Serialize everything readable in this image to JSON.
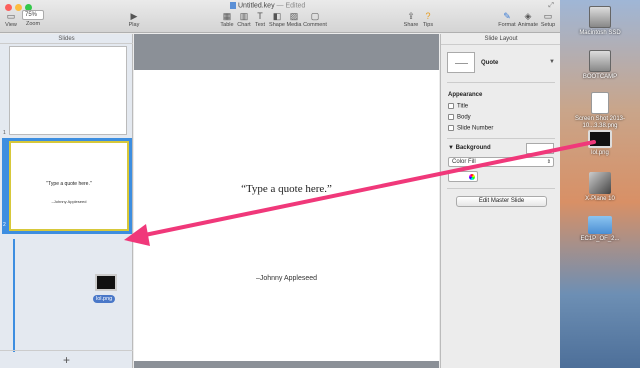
{
  "window": {
    "title": "Untitled.key",
    "status": "— Edited"
  },
  "toolbar": {
    "view_label": "View",
    "zoom_label": "Zoom",
    "zoom_value": "75%",
    "play_label": "Play",
    "table_label": "Table",
    "chart_label": "Chart",
    "text_label": "Text",
    "shape_label": "Shape",
    "media_label": "Media",
    "comment_label": "Comment",
    "share_label": "Share",
    "tips_label": "Tips",
    "format_label": "Format",
    "animate_label": "Animate",
    "setup_label": "Setup"
  },
  "sidebar": {
    "header": "Slides",
    "slides": [
      {
        "number": "1",
        "quote": "",
        "attribution": ""
      },
      {
        "number": "2",
        "quote": "\"Type a quote here.\"",
        "attribution": "–Johnny Appleseed"
      }
    ],
    "drag_file_label": "lol.png",
    "add_label": "+"
  },
  "slide": {
    "quote": "“Type a quote here.”",
    "attribution": "–Johnny Appleseed"
  },
  "inspector": {
    "header": "Slide Layout",
    "layout_name": "Quote",
    "appearance_title": "Appearance",
    "checkboxes": [
      "Title",
      "Body",
      "Slide Number"
    ],
    "background_title": "Background",
    "fill_type": "Color Fill",
    "edit_master_label": "Edit Master Slide"
  },
  "desktop": {
    "icons": [
      {
        "name": "Macintosh SSD"
      },
      {
        "name": "BOOTCAMP"
      },
      {
        "name": "Screen Shot 2013-10...3.38.png"
      },
      {
        "name": "lol.png"
      },
      {
        "name": "X-Plane 10"
      },
      {
        "name": "EC1P_OF_2..."
      }
    ]
  },
  "colors": {
    "arrow": "#f0387a",
    "selection": "#3d8ee0",
    "selected_border": "#d7c83a"
  }
}
